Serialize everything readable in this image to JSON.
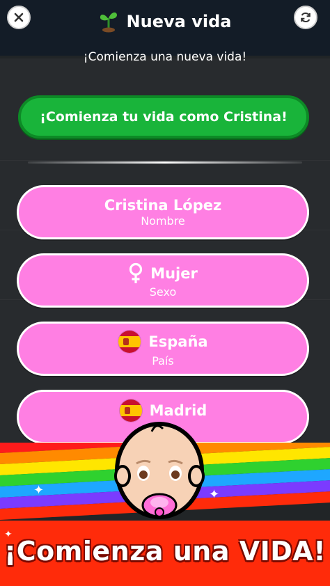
{
  "header": {
    "title": "Nueva vida",
    "subtitle": "¡Comienza una nueva vida!"
  },
  "start_button": {
    "label": "¡Comienza tu vida como Cristina!"
  },
  "options": [
    {
      "value": "Cristina López",
      "caption": "Nombre",
      "icon": "none"
    },
    {
      "value": "Mujer",
      "caption": "Sexo",
      "icon": "female-symbol-icon"
    },
    {
      "value": "España",
      "caption": "País",
      "icon": "spain-flag-icon"
    },
    {
      "value": "Madrid",
      "caption": "",
      "icon": "spain-flag-icon"
    }
  ],
  "banner": {
    "text": "¡Comienza una VIDA!"
  },
  "colors": {
    "start_green": "#19b43a",
    "option_pink": "#ff7fe3",
    "banner_red": "#ff2b0a"
  }
}
